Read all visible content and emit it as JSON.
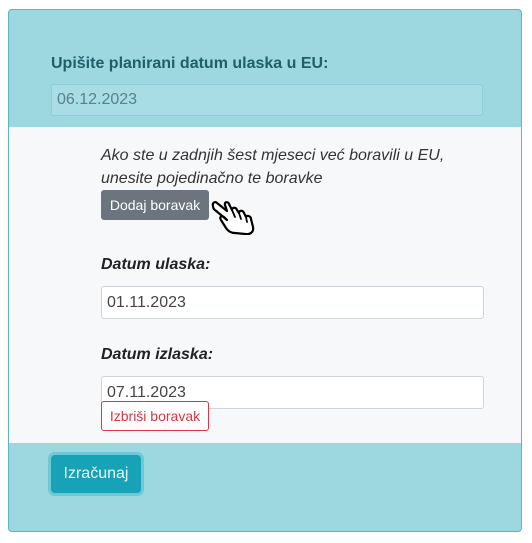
{
  "form": {
    "entry_label": "Upišite planirani datum ulaska u EU:",
    "entry_value": "06.12.2023"
  },
  "stays": {
    "hint": "Ako ste u zadnjih šest mjeseci već boravili u EU, unesite pojedinačno te boravke",
    "add_button": "Dodaj boravak",
    "items": [
      {
        "entry_label": "Datum ulaska:",
        "entry_value": "01.11.2023",
        "exit_label": "Datum izlaska:",
        "exit_value": "07.11.2023",
        "delete_button": "Izbriši boravak"
      }
    ]
  },
  "actions": {
    "calculate_button": "Izračunaj"
  },
  "icons": {
    "cursor": "pointing-hand-icon"
  },
  "colors": {
    "panel_bg": "#9dd7e0",
    "primary": "#17a2b8",
    "secondary": "#6c757d",
    "danger": "#dc3545"
  }
}
